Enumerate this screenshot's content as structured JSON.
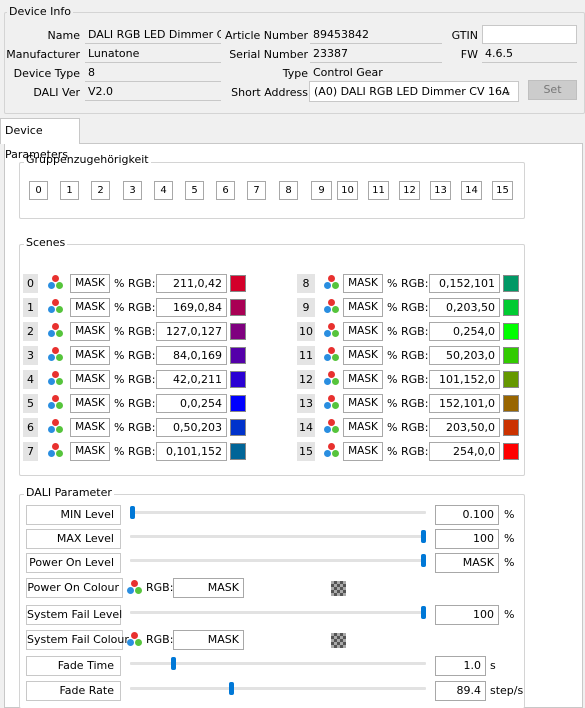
{
  "device_info": {
    "section_label": "Device Info",
    "name_label": "Name",
    "name_value": "DALI RGB LED Dimmer C...",
    "manufacturer_label": "Manufacturer",
    "manufacturer_value": "Lunatone",
    "device_type_label": "Device Type",
    "device_type_value": "8",
    "dali_ver_label": "DALI Ver",
    "dali_ver_value": "V2.0",
    "article_number_label": "Article Number",
    "article_number_value": "89453842",
    "serial_number_label": "Serial Number",
    "serial_number_value": "23387",
    "type_label": "Type",
    "type_value": "Control Gear",
    "short_address_label": "Short Address",
    "short_address_value": "(A0) DALI RGB LED Dimmer CV 16A",
    "gtin_label": "GTIN",
    "gtin_value": "",
    "fw_label": "FW",
    "fw_value": "4.6.5",
    "set_button": "Set"
  },
  "tab": {
    "label": "Device Parameters"
  },
  "groups": {
    "title": "Gruppenzugehörigkeit",
    "items": [
      "0",
      "1",
      "2",
      "3",
      "4",
      "5",
      "6",
      "7",
      "8",
      "9",
      "10",
      "11",
      "12",
      "13",
      "14",
      "15"
    ]
  },
  "scenes": {
    "title": "Scenes",
    "mask_label": "MASK",
    "percent": "%",
    "rgb_label": "RGB:",
    "items": [
      {
        "index": "0",
        "rgb": "211,0,42",
        "color": "#d3002a"
      },
      {
        "index": "1",
        "rgb": "169,0,84",
        "color": "#a90054"
      },
      {
        "index": "2",
        "rgb": "127,0,127",
        "color": "#7f007f"
      },
      {
        "index": "3",
        "rgb": "84,0,169",
        "color": "#5400a9"
      },
      {
        "index": "4",
        "rgb": "42,0,211",
        "color": "#2a00d3"
      },
      {
        "index": "5",
        "rgb": "0,0,254",
        "color": "#0000fe"
      },
      {
        "index": "6",
        "rgb": "0,50,203",
        "color": "#0032cb"
      },
      {
        "index": "7",
        "rgb": "0,101,152",
        "color": "#006598"
      },
      {
        "index": "8",
        "rgb": "0,152,101",
        "color": "#009865"
      },
      {
        "index": "9",
        "rgb": "0,203,50",
        "color": "#00cb32"
      },
      {
        "index": "10",
        "rgb": "0,254,0",
        "color": "#00fe00"
      },
      {
        "index": "11",
        "rgb": "50,203,0",
        "color": "#32cb00"
      },
      {
        "index": "12",
        "rgb": "101,152,0",
        "color": "#659800"
      },
      {
        "index": "13",
        "rgb": "152,101,0",
        "color": "#986500"
      },
      {
        "index": "14",
        "rgb": "203,50,0",
        "color": "#cb3200"
      },
      {
        "index": "15",
        "rgb": "254,0,0",
        "color": "#fe0000"
      }
    ]
  },
  "dali_parameter": {
    "title": "DALI Parameter",
    "min_level": {
      "label": "MIN Level",
      "value": "0.100",
      "unit": "%",
      "fraction": 0.0
    },
    "max_level": {
      "label": "MAX Level",
      "value": "100",
      "unit": "%",
      "fraction": 1.0
    },
    "power_on_level": {
      "label": "Power On Level",
      "value": "MASK",
      "unit": "%",
      "fraction": 1.0
    },
    "power_on_colour": {
      "label": "Power On Colour",
      "rgb_label": "RGB:",
      "value": "MASK"
    },
    "system_fail_level": {
      "label": "System Fail Level",
      "value": "100",
      "unit": "%",
      "fraction": 1.0
    },
    "system_fail_colour": {
      "label": "System Fail Colour",
      "rgb_label": "RGB:",
      "value": "MASK"
    },
    "fade_time": {
      "label": "Fade Time",
      "value": "1.0",
      "unit": "s",
      "fraction": 0.14
    },
    "fade_rate": {
      "label": "Fade Rate",
      "value": "89.4",
      "unit": "step/s",
      "fraction": 0.34
    }
  }
}
